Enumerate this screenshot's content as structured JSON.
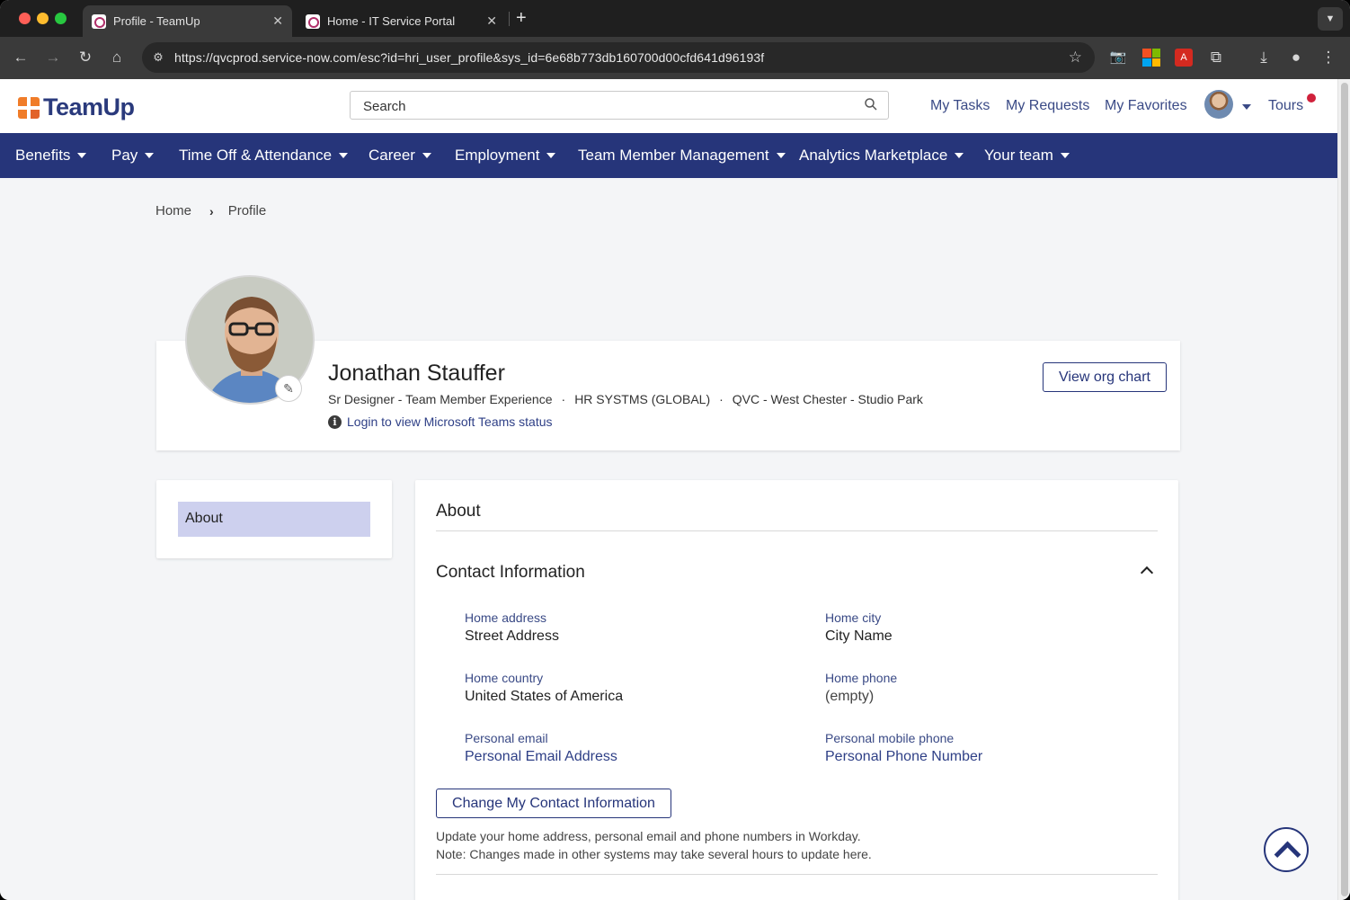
{
  "browser": {
    "tabs": [
      {
        "title": "Profile - TeamUp",
        "active": true
      },
      {
        "title": "Home - IT Service Portal",
        "active": false
      }
    ],
    "url": "https://qvcprod.service-now.com/esc?id=hri_user_profile&sys_id=6e68b773db160700d00cfd641d96193f"
  },
  "header": {
    "logo_text": "TeamUp",
    "search_placeholder": "Search",
    "links": [
      "My Tasks",
      "My Requests",
      "My Favorites"
    ],
    "tours": "Tours"
  },
  "nav": {
    "items": [
      "Benefits",
      "Pay",
      "Time Off & Attendance",
      "Career",
      "Employment",
      "Team Member Management",
      "Analytics Marketplace",
      "Your team"
    ]
  },
  "breadcrumb": [
    "Home",
    "Profile"
  ],
  "profile": {
    "name": "Jonathan Stauffer",
    "title": "Sr Designer - Team Member Experience",
    "department": "HR SYSTMS (GLOBAL)",
    "location": "QVC - West Chester - Studio Park",
    "teams_status": "Login to view Microsoft Teams status",
    "org_chart_button": "View org chart"
  },
  "sidebar": {
    "items": [
      "About"
    ]
  },
  "about": {
    "heading": "About",
    "section_title": "Contact Information",
    "fields": [
      {
        "label": "Home address",
        "value": "Street Address"
      },
      {
        "label": "Home city",
        "value": "City Name"
      },
      {
        "label": "Home country",
        "value": "United States of America"
      },
      {
        "label": "Home phone",
        "value": "(empty)"
      },
      {
        "label": "Personal email",
        "value": "Personal Email Address"
      },
      {
        "label": "Personal mobile phone",
        "value": "Personal Phone Number"
      }
    ],
    "change_button": "Change My Contact Information",
    "note_line1": "Update your home address, personal email and phone numbers in Workday.",
    "note_line2": "Note: Changes made in other systems may take several hours to update here."
  },
  "colors": {
    "nav_bg": "#26357a",
    "accent": "#f07c29",
    "link": "#2e3f86",
    "notification": "#d0213b"
  }
}
